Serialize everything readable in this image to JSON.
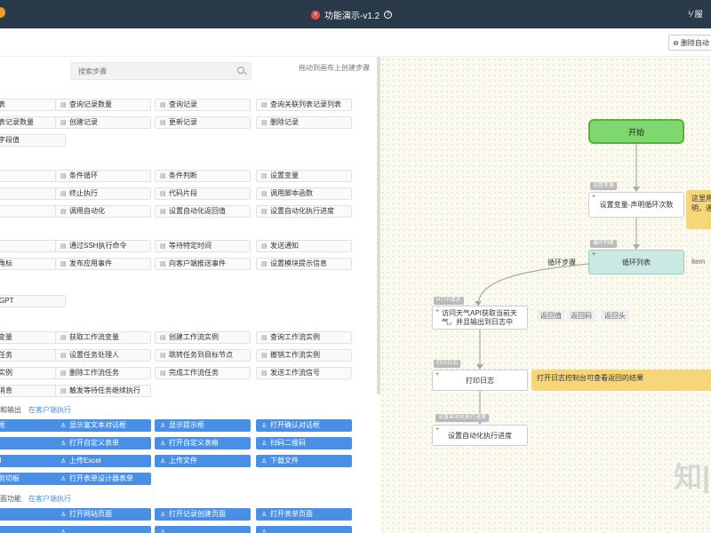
{
  "topbar": {
    "title": "功能演示-v1.2",
    "badge": "Y",
    "help": "?",
    "right_label": "⅟ 服"
  },
  "toolbar": {
    "delete_label": "⊖ 删除自动"
  },
  "search": {
    "placeholder": "搜索步骤"
  },
  "hint": "拖动到画布上创建步骤",
  "record_steps": [
    [
      "联列表",
      "查询记录数量",
      "查询记录",
      "查询关联列表记录列表"
    ],
    [
      "联列表记录数量",
      "创建记录",
      "更新记录",
      "删除记录"
    ],
    [
      "汇总字段值"
    ]
  ],
  "flow_steps": [
    [
      "环",
      "条件循环",
      "条件判断",
      "设置变量"
    ],
    [
      "续",
      "终止执行",
      "代码片段",
      "调用脚本函数"
    ],
    [
      "志",
      "调用自动化",
      "设置自动化返回值",
      "设置自动化执行进度"
    ]
  ],
  "comm_steps": [
    [
      "请求",
      "通过SSH执行命令",
      "等待特定时间",
      "发送通知"
    ],
    [
      "推的角标",
      "发布应用事件",
      "向客户端推送事件",
      "设置模块提示信息"
    ]
  ],
  "ai_steps": [
    [
      "ChatGPT"
    ]
  ],
  "workflow_steps": [
    [
      "作流变量",
      "获取工作流变量",
      "创建工作流实例",
      "查询工作流实例"
    ],
    [
      "作流任务",
      "设置任务处理人",
      "跳转任务到目标节点",
      "撤销工作流实例"
    ],
    [
      "作流实例",
      "删除工作流任务",
      "完成工作流任务",
      "发送工作流信号"
    ],
    [
      "作流消息",
      "触发等待任务继续执行"
    ]
  ],
  "io_section": {
    "label": "和输出",
    "link": "在客户端执行"
  },
  "io_buttons": [
    [
      "对话框",
      "显示富文本对话框",
      "显示提示框",
      "打开确认对话框"
    ],
    [
      "印",
      "打开自定义表单",
      "打开自定义表格",
      "扫码二维码"
    ],
    [
      "Excel",
      "上传Excel",
      "上传文件",
      "下载文件"
    ],
    [
      "本到剪切板",
      "打开表单设计器表单"
    ]
  ],
  "ui_section": {
    "label": "面功能",
    "link": "在客户端执行"
  },
  "ui_buttons": [
    [
      "",
      "打开网站页面",
      "打开记录创建页面",
      "打开表单页面"
    ],
    [
      "",
      "",
      "",
      ""
    ]
  ],
  "canvas": {
    "start": "开始",
    "set_var_tag": "设置变量",
    "set_var": "设置变量-声明循环次数",
    "loop_tag": "循环列表",
    "loop": "循环列表",
    "loop_label": "循环步骤",
    "item_label": "item",
    "http_tag": "HTTP请求",
    "http": "访问天气API获取当前天气，并且输出到日志中",
    "pills": [
      "返回值",
      "返回码",
      "返回头"
    ],
    "log_tag": "打印日志",
    "log": "打印日志",
    "log_note": "打开日志控制台可查看返回的结果",
    "progress_tag": "设置自动化执行进度",
    "progress": "设置自动化执行进度",
    "side_note": "这里用\n明，通",
    "watermark": "知|"
  }
}
